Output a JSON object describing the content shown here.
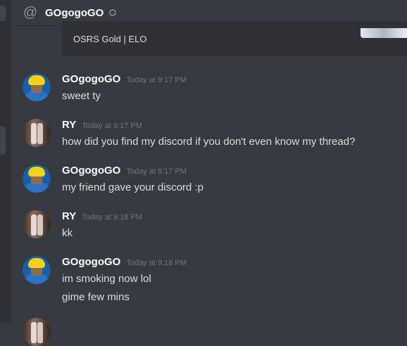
{
  "header": {
    "title": "GOgogoGO",
    "icon": "at-icon"
  },
  "embed": {
    "footer": "OSRS Gold | ELO"
  },
  "messages": [
    {
      "author": "GOgogoGO",
      "time": "Today at 9:17 PM",
      "lines": [
        "sweet ty"
      ]
    },
    {
      "author": "RY",
      "time": "Today at 9:17 PM",
      "lines": [
        "how did you find my discord if you don't even know my thread?"
      ]
    },
    {
      "author": "GOgogoGO",
      "time": "Today at 9:17 PM",
      "lines": [
        "my friend gave your discord :p"
      ]
    },
    {
      "author": "RY",
      "time": "Today at 9:18 PM",
      "lines": [
        "kk"
      ]
    },
    {
      "author": "GOgogoGO",
      "time": "Today at 9:18 PM",
      "lines": [
        "im smoking now lol",
        "gime few mins"
      ]
    }
  ]
}
